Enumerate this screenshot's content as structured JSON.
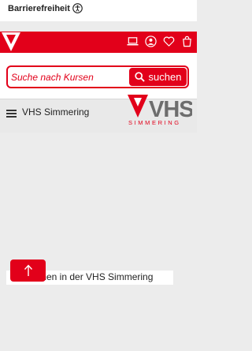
{
  "accessibility": {
    "label": "Barrierefreiheit",
    "icon": "accessibility-icon"
  },
  "header": {
    "icons": [
      "laptop-icon",
      "user-icon",
      "heart-icon",
      "cart-icon"
    ],
    "brand_color": "#e2001a"
  },
  "search": {
    "placeholder": "Suche nach Kursen",
    "button_label": "suchen"
  },
  "nav": {
    "title": "VHS Simmering",
    "logo_text": "VHS",
    "logo_subtext": "SIMMERING"
  },
  "main": {
    "welcome": "…men in der VHS Simmering"
  }
}
